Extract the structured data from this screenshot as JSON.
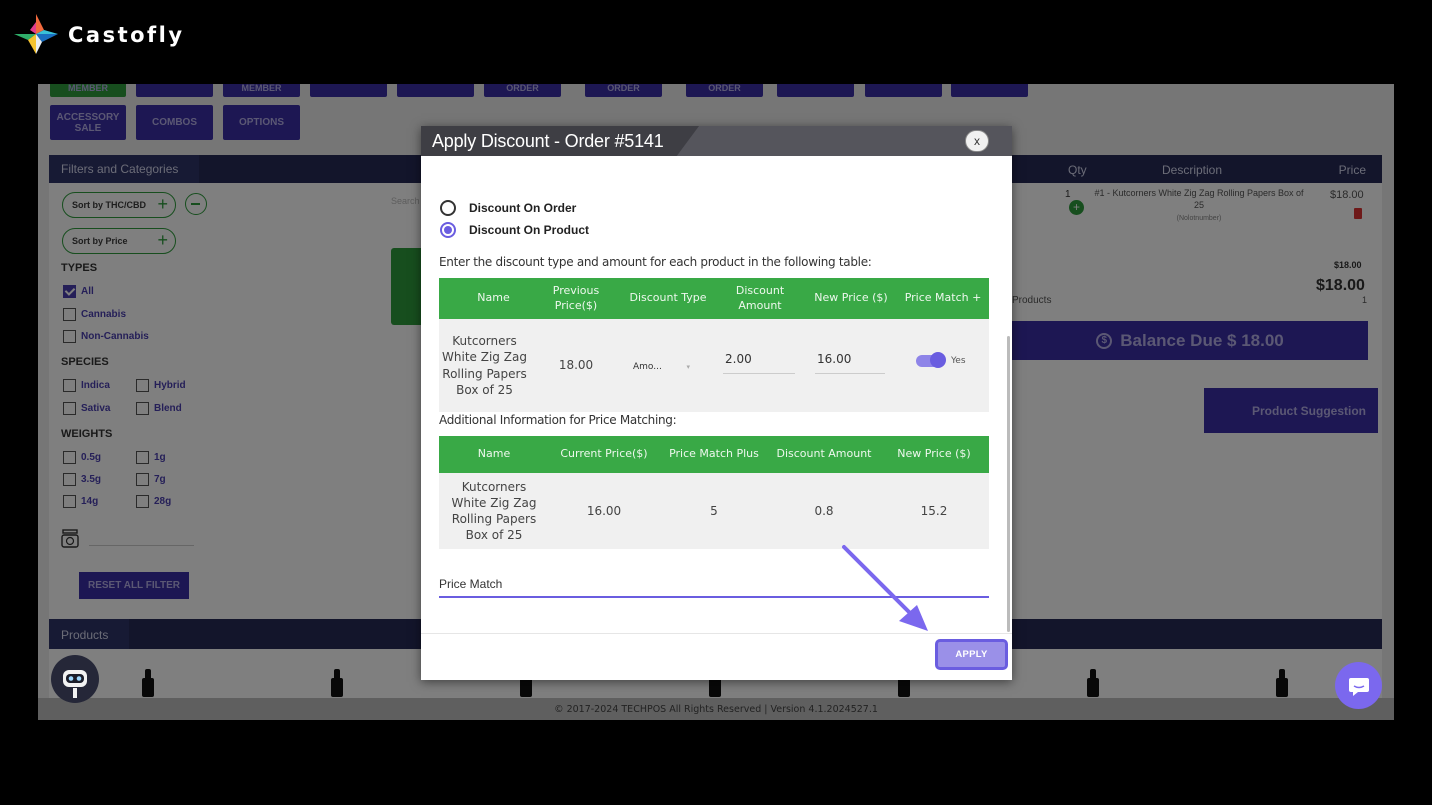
{
  "brand": {
    "name": "Castofly"
  },
  "topbar": {
    "row1": [
      "MEMBER",
      "",
      "MEMBER",
      "",
      "",
      "ORDER",
      "ORDER",
      "ORDER",
      "",
      "",
      ""
    ],
    "accessory_sale": "ACCESSORY SALE",
    "combos": "COMBOS",
    "options": "OPTIONS"
  },
  "filters": {
    "title": "Filters and Categories",
    "sort_thc": "Sort by THC/CBD",
    "sort_price": "Sort by Price",
    "search_hint": "Search",
    "types_label": "TYPES",
    "types": [
      "All",
      "Cannabis",
      "Non-Cannabis"
    ],
    "species_label": "SPECIES",
    "species": [
      "Indica",
      "Hybrid",
      "Sativa",
      "Blend"
    ],
    "weights_label": "WEIGHTS",
    "weights": [
      "0.5g",
      "1g",
      "3.5g",
      "7g",
      "14g",
      "28g"
    ],
    "reset": "RESET ALL FILTER"
  },
  "products": {
    "title": "Products"
  },
  "cart": {
    "col_qty": "Qty",
    "col_desc": "Description",
    "col_price": "Price",
    "item_qty": "1",
    "item_desc": "#1 - Kutcorners White Zig Zag Rolling Papers Box of 25",
    "item_note": "(Nolotnumber)",
    "item_price": "$18.00",
    "subtotal_small": "$18.00",
    "total": "$18.00",
    "products_label": "Products",
    "products_count": "1",
    "balance_due": "Balance Due $ 18.00",
    "product_suggestion": "Product Suggestion"
  },
  "footer": {
    "text": "© 2017-2024 TECHPOS All Rights Reserved | Version 4.1.2024527.1"
  },
  "modal": {
    "title": "Apply Discount - Order #5141",
    "close": "x",
    "radio_order": "Discount On Order",
    "radio_product": "Discount On Product",
    "instruction": "Enter the discount type and amount for each product in the following table:",
    "table1": {
      "headers": [
        "Name",
        "Previous Price($)",
        "Discount Type",
        "Discount Amount",
        "New Price ($)",
        "Price Match +"
      ],
      "row": {
        "name": "Kutcorners White Zig Zag Rolling Papers Box of 25",
        "previous_price": "18.00",
        "discount_type": "Amo...",
        "discount_amount": "2.00",
        "new_price": "16.00",
        "price_match": "Yes",
        "price_match_on": true
      }
    },
    "additional_label": "Additional Information for Price Matching:",
    "table2": {
      "headers": [
        "Name",
        "Current Price($)",
        "Price Match Plus",
        "Discount Amount",
        "New Price ($)"
      ],
      "row": {
        "name": "Kutcorners White Zig Zag Rolling Papers Box of 25",
        "current_price": "16.00",
        "price_match_plus": "5",
        "discount_amount": "0.8",
        "new_price": "15.2"
      }
    },
    "price_match_label": "Price Match",
    "apply": "APPLY"
  },
  "colors": {
    "accent": "#6a5de0",
    "table_header": "#39a946",
    "nav_purple": "#3a2ea6",
    "arrow": "#7b68ee"
  }
}
